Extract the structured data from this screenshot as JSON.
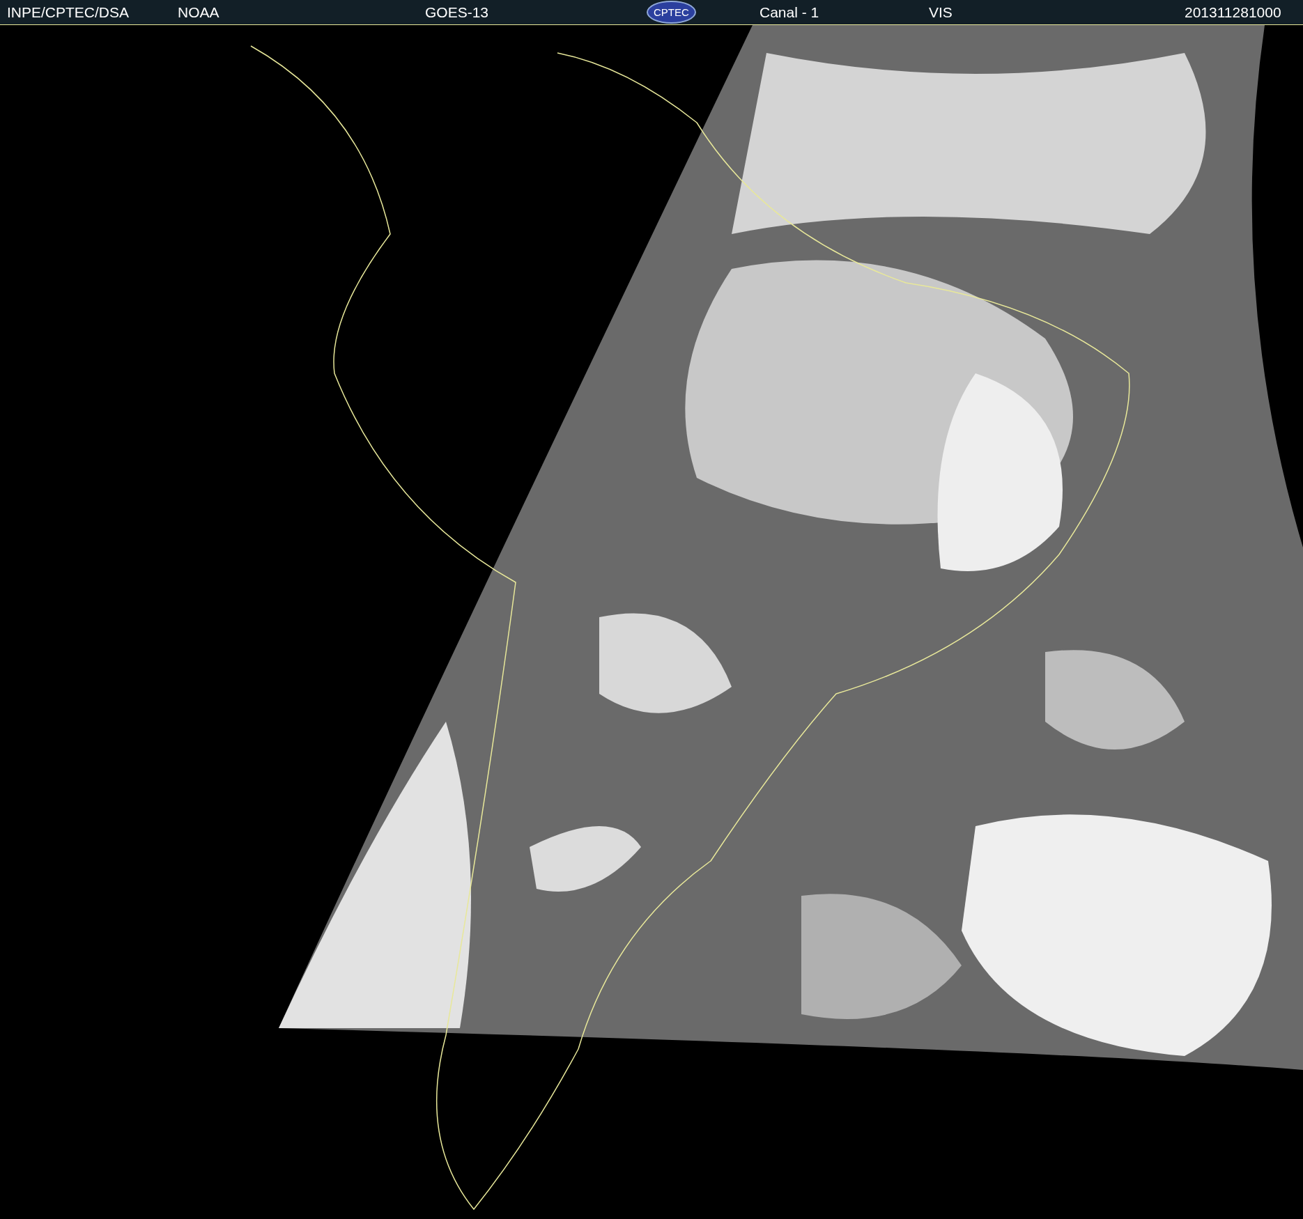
{
  "header": {
    "items": [
      {
        "kind": "text",
        "text": "INPE/CPTEC/DSA"
      },
      {
        "kind": "text",
        "text": "NOAA"
      },
      {
        "kind": "text",
        "text": "GOES-13"
      },
      {
        "kind": "logo",
        "text": "CPTEC"
      },
      {
        "kind": "text",
        "text": "Canal - 1"
      },
      {
        "kind": "text",
        "text": "VIS"
      },
      {
        "kind": "text",
        "text": "201311281000"
      }
    ]
  }
}
